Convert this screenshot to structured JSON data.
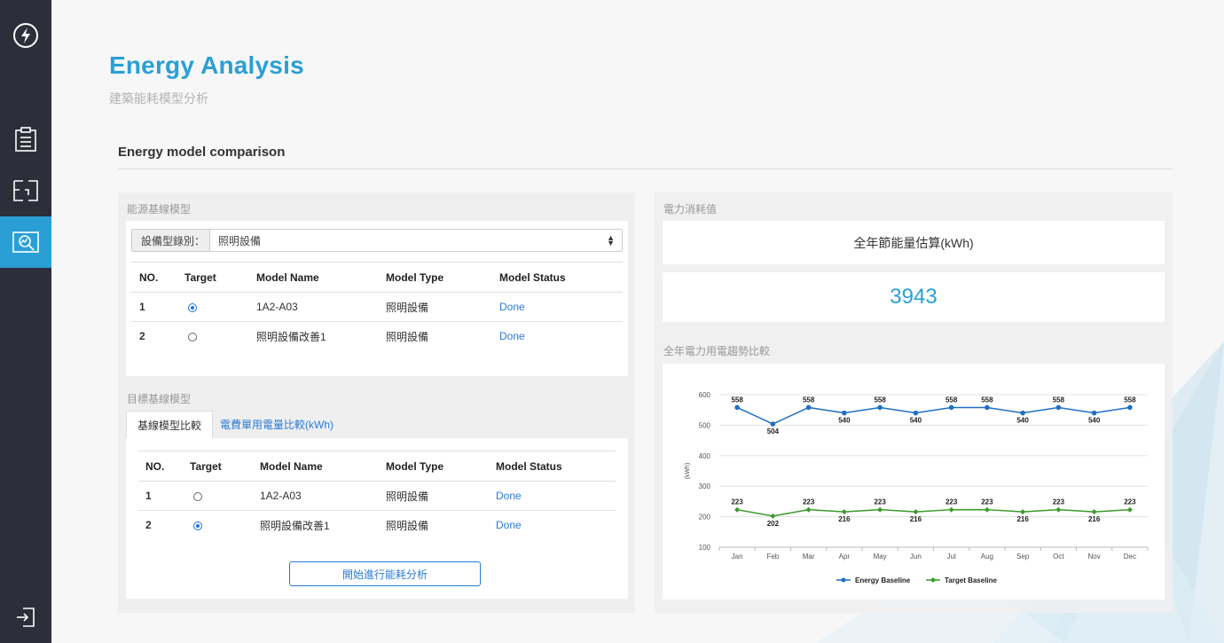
{
  "page": {
    "title": "Energy Analysis",
    "subtitle": "建築能耗模型分析",
    "section_title": "Energy model comparison"
  },
  "sidebar": {
    "items": [
      {
        "icon": "lightning-logo-icon",
        "active": false
      },
      {
        "icon": "clipboard-icon",
        "active": false
      },
      {
        "icon": "floor-plan-icon",
        "active": false
      },
      {
        "icon": "analysis-chart-icon",
        "active": true
      },
      {
        "icon": "logout-icon",
        "active": false
      }
    ],
    "accent": "#2a9fd6"
  },
  "baseline_model": {
    "caption": "能源基線模型",
    "select_label": "設備型錄別：",
    "select_value": "照明設備",
    "headers": [
      "NO.",
      "Target",
      "Model Name",
      "Model Type",
      "Model Status"
    ],
    "rows": [
      {
        "no": "1",
        "target": true,
        "name": "1A2-A03",
        "type": "照明設備",
        "status": "Done"
      },
      {
        "no": "2",
        "target": false,
        "name": "照明設備改善1",
        "type": "照明設備",
        "status": "Done"
      }
    ]
  },
  "target_model": {
    "caption": "目標基線模型",
    "tabs": [
      "基線模型比較",
      "電費單用電量比較(kWh)"
    ],
    "headers": [
      "NO.",
      "Target",
      "Model Name",
      "Model Type",
      "Model Status"
    ],
    "rows": [
      {
        "no": "1",
        "target": false,
        "name": "1A2-A03",
        "type": "照明設備",
        "status": "Done"
      },
      {
        "no": "2",
        "target": true,
        "name": "照明設備改善1",
        "type": "照明設備",
        "status": "Done"
      }
    ],
    "button_label": "開始進行能耗分析"
  },
  "power": {
    "caption": "電力消耗值",
    "card_title": "全年節能量估算(kWh)",
    "value": "3943",
    "trend_caption": "全年電力用電趨勢比較"
  },
  "chart_data": {
    "type": "line",
    "categories": [
      "Jan",
      "Feb",
      "Mar",
      "Apr",
      "May",
      "Jun",
      "Jul",
      "Aug",
      "Sep",
      "Oct",
      "Nov",
      "Dec"
    ],
    "series": [
      {
        "name": "Energy Baseline",
        "color": "#1f6fc5",
        "values": [
          558,
          504,
          558,
          540,
          558,
          540,
          558,
          558,
          540,
          558,
          540,
          558
        ]
      },
      {
        "name": "Target Baseline",
        "color": "#3a9a2a",
        "values": [
          223,
          202,
          223,
          216,
          223,
          216,
          223,
          223,
          216,
          223,
          216,
          223
        ]
      }
    ],
    "ylabel": "(kWh)",
    "ylim": [
      100,
      600
    ],
    "yticks": [
      100,
      200,
      300,
      400,
      500,
      600
    ],
    "grid": true,
    "legend": "bottom-center",
    "data_labels": true
  }
}
